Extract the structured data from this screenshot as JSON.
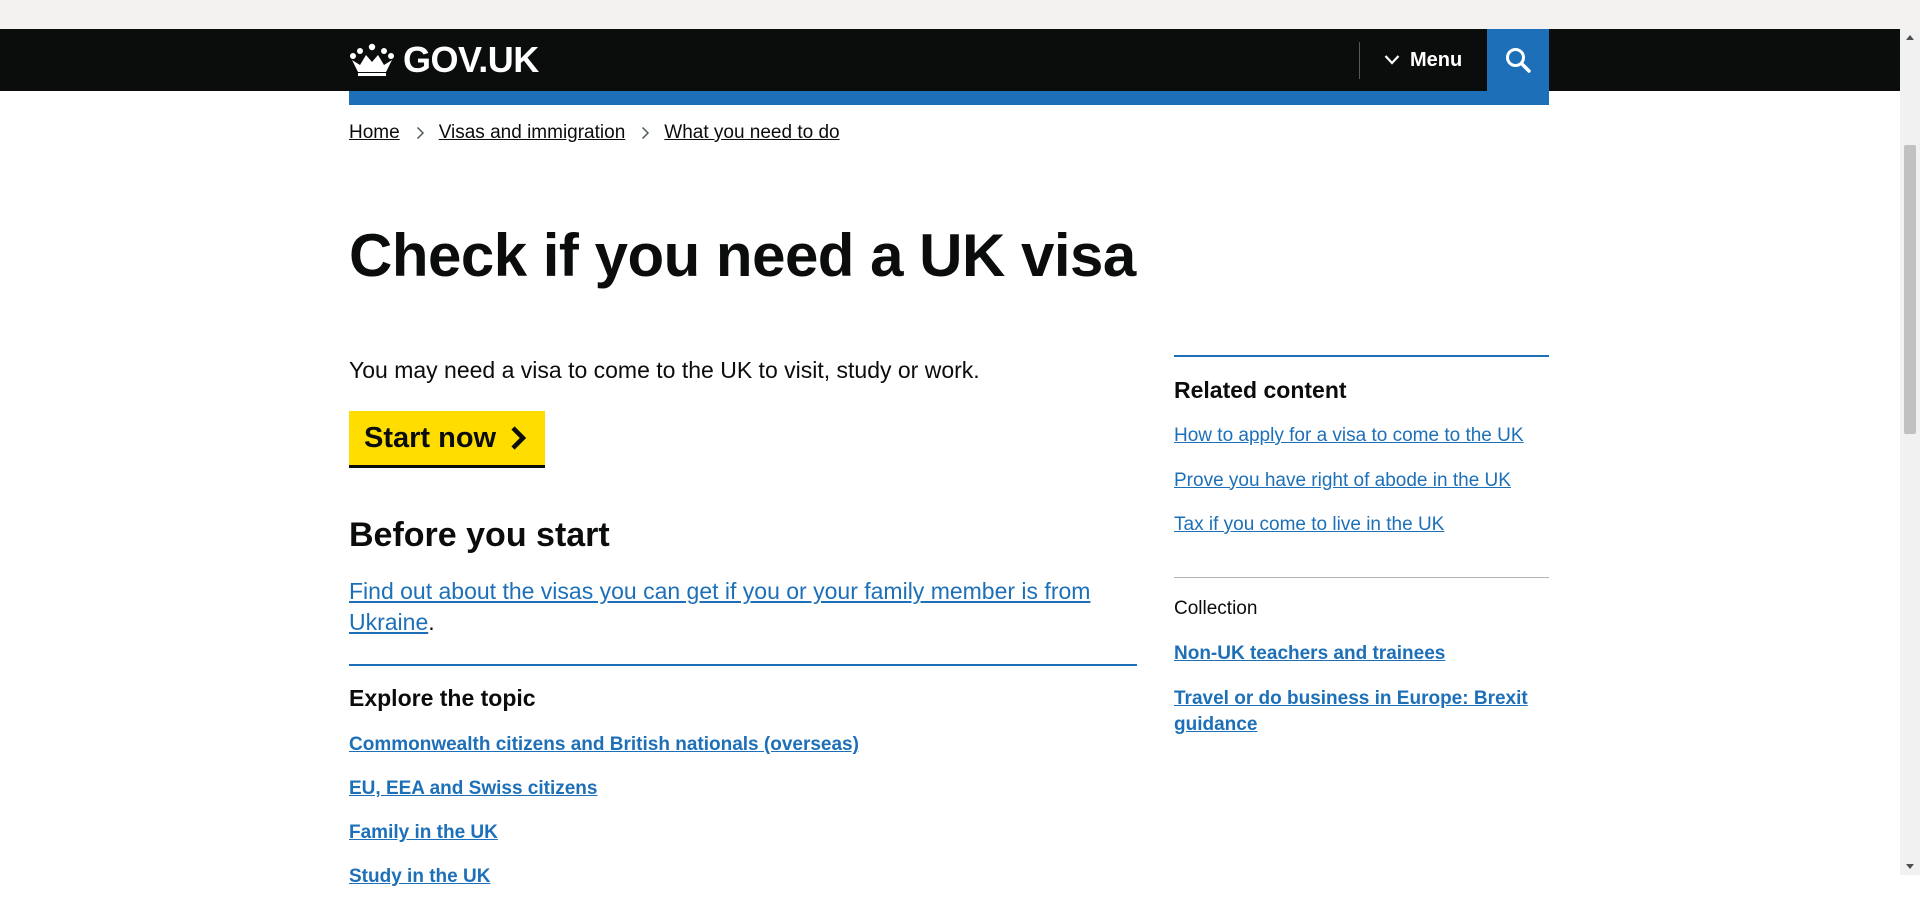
{
  "header": {
    "logo_text": "GOV.UK",
    "menu_label": "Menu",
    "search_label": "Search GOV.UK"
  },
  "breadcrumb": [
    "Home",
    "Visas and immigration",
    "What you need to do"
  ],
  "page": {
    "title": "Check if you need a UK visa",
    "lead": "You may need a visa to come to the UK to visit, study or work.",
    "start_button": "Start now",
    "before_heading": "Before you start",
    "ukraine_link": "Find out about the visas you can get if you or your family member is from Ukraine",
    "ukraine_suffix": "."
  },
  "explore": {
    "heading": "Explore the topic",
    "links": [
      "Commonwealth citizens and British nationals (overseas)",
      "EU, EEA and Swiss citizens",
      "Family in the UK",
      "Study in the UK"
    ]
  },
  "related": {
    "heading": "Related content",
    "links": [
      "How to apply for a visa to come to the UK",
      "Prove you have right of abode in the UK",
      "Tax if you come to live in the UK"
    ],
    "collection_label": "Collection",
    "collection_links": [
      "Non-UK teachers and trainees",
      "Travel or do business in Europe: Brexit guidance"
    ]
  },
  "colors": {
    "header_bg": "#0b0c0c",
    "link_blue": "#1d70b8",
    "start_button_bg": "#ffdd00",
    "text": "#0b0c0c"
  },
  "icons": [
    "crown-icon",
    "chevron-down-icon",
    "search-icon",
    "chevron-right-icon",
    "arrow-right-icon"
  ]
}
